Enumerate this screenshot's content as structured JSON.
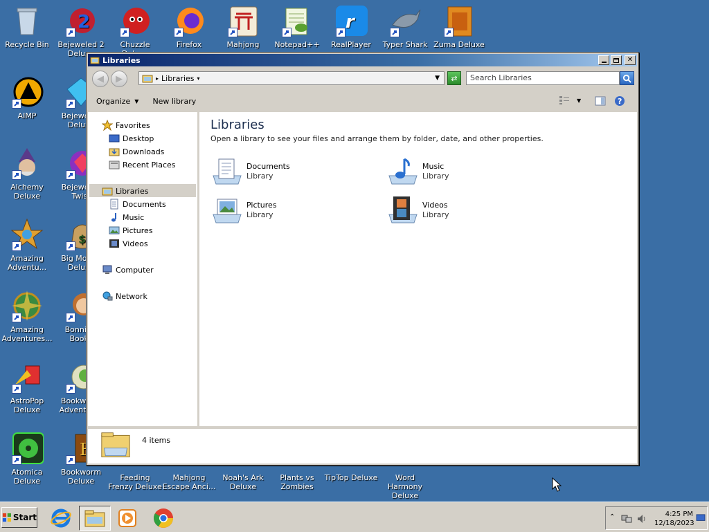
{
  "desktop": {
    "icons": [
      {
        "label": "Recycle Bin"
      },
      {
        "label": "Bejeweled 2 Deluxe"
      },
      {
        "label": "Chuzzle Deluxe"
      },
      {
        "label": "Firefox"
      },
      {
        "label": "Mahjong"
      },
      {
        "label": "Notepad++"
      },
      {
        "label": "RealPlayer"
      },
      {
        "label": "Typer Shark"
      },
      {
        "label": "Zuma Deluxe"
      },
      {
        "label": "AIMP"
      },
      {
        "label": "Bejeweled Deluxe"
      },
      {
        "label": "Alchemy Deluxe"
      },
      {
        "label": "Bejeweled Twist"
      },
      {
        "label": "Amazing Adventu..."
      },
      {
        "label": "Big Money Deluxe"
      },
      {
        "label": "Amazing Adventures..."
      },
      {
        "label": "Bonnie's Books"
      },
      {
        "label": "AstroPop Deluxe"
      },
      {
        "label": "Bookworm Adventures"
      },
      {
        "label": "Atomica Deluxe"
      },
      {
        "label": "Bookworm Deluxe"
      },
      {
        "label": "Feeding Frenzy Deluxe"
      },
      {
        "label": "Mahjong Escape Anci..."
      },
      {
        "label": "Noah's Ark Deluxe"
      },
      {
        "label": "Plants vs Zombies"
      },
      {
        "label": "TipTop Deluxe"
      },
      {
        "label": "Word Harmony Deluxe"
      }
    ]
  },
  "window": {
    "title": "Libraries",
    "address_crumb": "Libraries",
    "search_placeholder": "Search Libraries",
    "toolbar": {
      "organize": "Organize",
      "new_library": "New library"
    },
    "nav": {
      "favorites": "Favorites",
      "desktop": "Desktop",
      "downloads": "Downloads",
      "recent_places": "Recent Places",
      "libraries": "Libraries",
      "documents": "Documents",
      "music": "Music",
      "pictures": "Pictures",
      "videos": "Videos",
      "computer": "Computer",
      "network": "Network"
    },
    "content": {
      "title": "Libraries",
      "description": "Open a library to see your files and arrange them by folder, date, and other properties.",
      "libraries": [
        {
          "name": "Documents",
          "sub": "Library"
        },
        {
          "name": "Music",
          "sub": "Library"
        },
        {
          "name": "Pictures",
          "sub": "Library"
        },
        {
          "name": "Videos",
          "sub": "Library"
        }
      ]
    },
    "status": {
      "count": "4 items"
    }
  },
  "taskbar": {
    "start": "Start",
    "clock_time": "4:25 PM",
    "clock_date": "12/18/2023"
  }
}
